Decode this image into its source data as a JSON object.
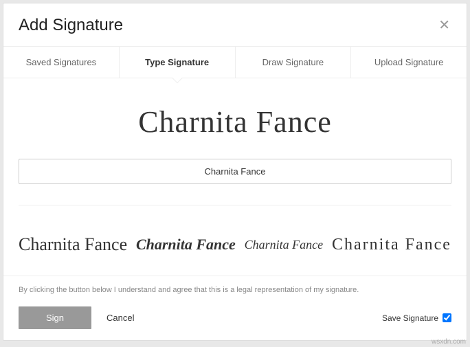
{
  "modal": {
    "title": "Add Signature"
  },
  "tabs": {
    "saved": "Saved Signatures",
    "type": "Type Signature",
    "draw": "Draw Signature",
    "upload": "Upload Signature"
  },
  "signature": {
    "preview": "Charnita Fance",
    "input_value": "Charnita Fance",
    "options": {
      "f1": "Charnita Fance",
      "f2": "Charnita Fance",
      "f3": "Charnita Fance",
      "f4": "Charnita Fance"
    }
  },
  "footer": {
    "disclaimer": "By clicking the button below I understand and agree that this is a legal representation of my signature.",
    "sign": "Sign",
    "cancel": "Cancel",
    "save_label": "Save Signature"
  },
  "watermark": "wsxdn.com"
}
